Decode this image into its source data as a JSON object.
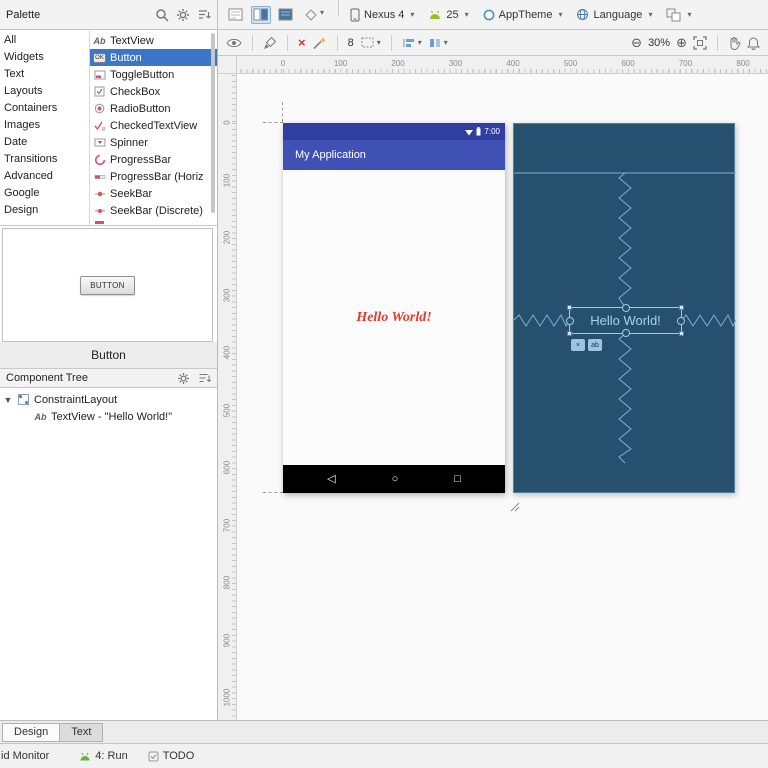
{
  "palette_panel": {
    "title": "Palette",
    "categories": [
      "All",
      "Widgets",
      "Text",
      "Layouts",
      "Containers",
      "Images",
      "Date",
      "Transitions",
      "Advanced",
      "Google",
      "Design"
    ],
    "components": [
      {
        "label": "TextView"
      },
      {
        "label": "Button"
      },
      {
        "label": "ToggleButton"
      },
      {
        "label": "CheckBox"
      },
      {
        "label": "RadioButton"
      },
      {
        "label": "CheckedTextView"
      },
      {
        "label": "Spinner"
      },
      {
        "label": "ProgressBar"
      },
      {
        "label": "ProgressBar (Horiz"
      },
      {
        "label": "SeekBar"
      },
      {
        "label": "SeekBar (Discrete)"
      }
    ],
    "selected_component": "Button",
    "preview": {
      "button_text": "BUTTON",
      "caption": "Button"
    }
  },
  "toolbar": {
    "device": "Nexus 4",
    "api_level": "25",
    "theme": "AppTheme",
    "language": "Language"
  },
  "design_toolbar": {
    "default_margin": "8",
    "zoom": "30%"
  },
  "component_tree": {
    "title": "Component Tree",
    "items": [
      {
        "label": "ConstraintLayout"
      },
      {
        "label": "TextView - \"Hello World!\""
      }
    ]
  },
  "canvas": {
    "app_title": "My Application",
    "status_time": "7:00",
    "hello_text": "Hello World!",
    "rulers": {
      "top": [
        "0",
        "100",
        "200",
        "300",
        "400",
        "500",
        "600",
        "700",
        "800"
      ],
      "left": [
        "0",
        "100",
        "200",
        "300",
        "400",
        "500",
        "600",
        "700",
        "800",
        "900",
        "1000"
      ]
    }
  },
  "bottom_bar": {
    "tabs": [
      {
        "label": "Design"
      },
      {
        "label": "Text"
      }
    ],
    "selected_tab": "Design",
    "status_items": {
      "monitor": "id Monitor",
      "run": "4: Run",
      "todo": "TODO"
    }
  },
  "icons": {
    "caret": "▾",
    "collapse_arrow": "▼",
    "ab_badge": "Ab",
    "ok_badge": "OK",
    "nav_back": "◁",
    "nav_home": "○",
    "nav_recents": "□",
    "zoom_out": "⊖",
    "zoom_in": "⊕",
    "autoconnect_off": "×",
    "chip_close": "×",
    "chip_baseline": "ab"
  },
  "colors": {
    "selection_blue": "#3c76c8",
    "app_bar": "#3f51b5",
    "status_bar": "#303f9f",
    "hello_red": "#dd3c2d",
    "blueprint_bg": "#26506d",
    "blueprint_accent": "#7fb0d4"
  }
}
